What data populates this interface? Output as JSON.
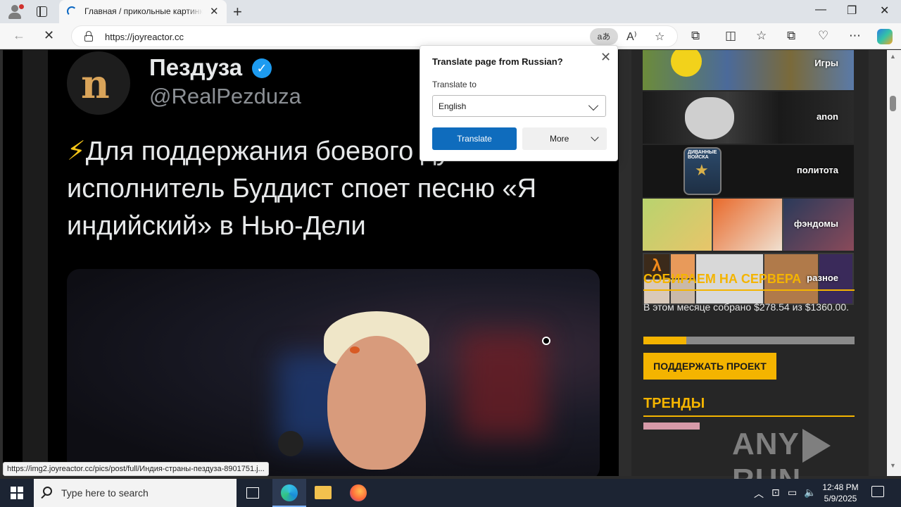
{
  "browser": {
    "tab_title": "Главная / прикольные картинки",
    "url": "https://joyreactor.cc",
    "translate_icon": "aあ",
    "window_controls": {
      "minimize": "—",
      "restore": "❐",
      "close": "✕"
    }
  },
  "tweet": {
    "author": "Пездуза",
    "handle": "@RealPezduza",
    "avatar_letter": "n",
    "bolt": "⚡",
    "text": "Для поддержания боевого духа исполнитель Буддист споет песню «Я индийский» в Нью-Дели"
  },
  "sidebar": {
    "categories": [
      {
        "label": "Игры"
      },
      {
        "label": "anon"
      },
      {
        "label": "политота"
      },
      {
        "label": "фэндомы"
      },
      {
        "label": "разное"
      }
    ],
    "badge_text": "ДИВАННЫЕ ВОЙСКА",
    "server_heading": "СОБИРАЕМ НА СЕРВЕРА",
    "server_text": "В этом месяце собрано $278.54 из $1360.00.",
    "progress_fraction": 0.2048,
    "support_button": "ПОДДЕРЖАТЬ ПРОЕКТ",
    "trends_heading": "ТРЕНДЫ"
  },
  "status_url": "https://img2.joyreactor.cc/pics/post/full/Индия-страны-пездуза-8901751.j...",
  "translate_popup": {
    "title": "Translate page from Russian?",
    "translate_to_label": "Translate to",
    "selected_language": "English",
    "translate_button": "Translate",
    "more_button": "More"
  },
  "watermark": {
    "left": "ANY",
    "right": "RUN"
  },
  "taskbar": {
    "search_placeholder": "Type here to search",
    "time": "12:48 PM",
    "date": "5/9/2025"
  },
  "colors": {
    "accent": "#f4b400",
    "translate_blue": "#0f6cbd",
    "taskbar": "#1c2433"
  }
}
